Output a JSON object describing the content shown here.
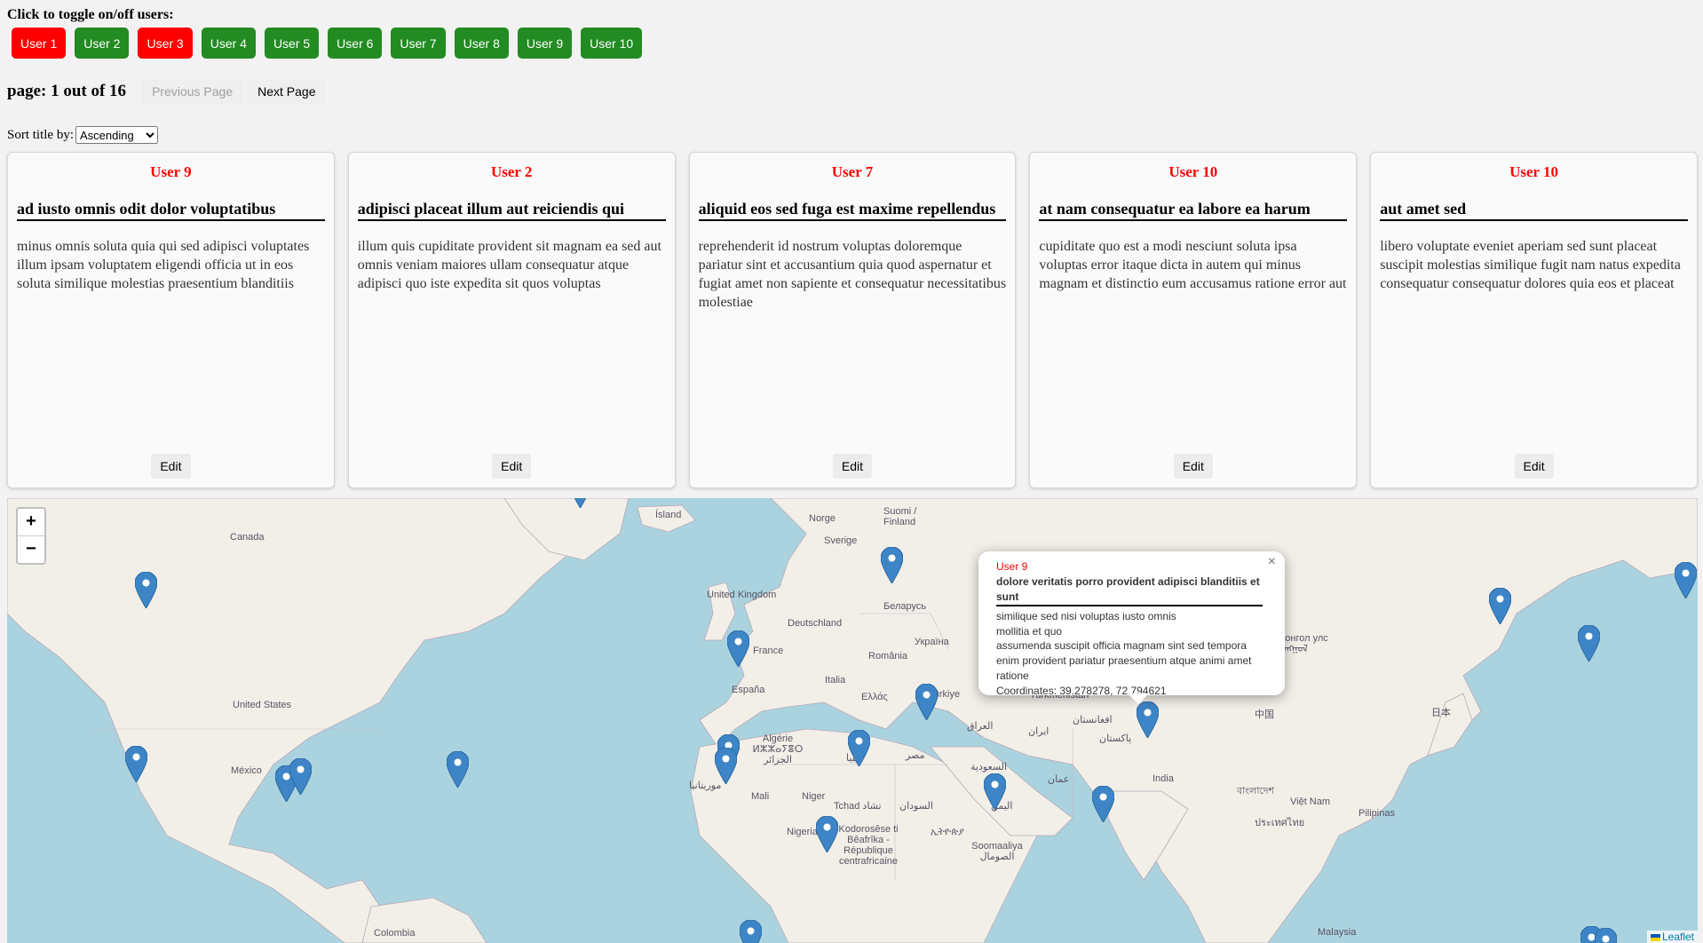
{
  "toggle": {
    "header": "Click to toggle on/off users:",
    "users": [
      {
        "label": "User 1",
        "state": "off"
      },
      {
        "label": "User 2",
        "state": "on"
      },
      {
        "label": "User 3",
        "state": "off"
      },
      {
        "label": "User 4",
        "state": "on"
      },
      {
        "label": "User 5",
        "state": "on"
      },
      {
        "label": "User 6",
        "state": "on"
      },
      {
        "label": "User 7",
        "state": "on"
      },
      {
        "label": "User 8",
        "state": "on"
      },
      {
        "label": "User 9",
        "state": "on"
      },
      {
        "label": "User 10",
        "state": "on"
      }
    ],
    "colors": {
      "on": "#228b22",
      "off": "#ff0000"
    }
  },
  "pager": {
    "label": "page: 1 out of 16",
    "prev": "Previous Page",
    "next": "Next Page"
  },
  "sort": {
    "label": "Sort title by:",
    "selected": "Ascending"
  },
  "cards": [
    {
      "user": "User 9",
      "title": "ad iusto omnis odit dolor voluptatibus",
      "body": "minus omnis soluta quia qui sed adipisci voluptates illum ipsam voluptatem eligendi officia ut in eos soluta similique molestias praesentium blanditiis",
      "edit": "Edit"
    },
    {
      "user": "User 2",
      "title": "adipisci placeat illum aut reiciendis qui",
      "body": "illum quis cupiditate provident sit magnam ea sed aut omnis veniam maiores ullam consequatur atque adipisci quo iste expedita sit quos voluptas",
      "edit": "Edit"
    },
    {
      "user": "User 7",
      "title": "aliquid eos sed fuga est maxime repellendus",
      "body": "reprehenderit id nostrum voluptas doloremque pariatur sint et accusantium quia quod aspernatur et fugiat amet non sapiente et consequatur necessitatibus molestiae",
      "edit": "Edit"
    },
    {
      "user": "User 10",
      "title": "at nam consequatur ea labore ea harum",
      "body": "cupiditate quo est a modi nesciunt soluta ipsa voluptas error itaque dicta in autem qui minus magnam et distinctio eum accusamus ratione error aut",
      "edit": "Edit"
    },
    {
      "user": "User 10",
      "title": "aut amet sed",
      "body": "libero voluptate eveniet aperiam sed sunt placeat suscipit molestias similique fugit nam natus expedita consequatur consequatur dolores quia eos et placeat",
      "edit": "Edit"
    }
  ],
  "map": {
    "zoom_in": "+",
    "zoom_out": "−",
    "attribution": "Leaflet",
    "labels": {
      "canada": "Canada",
      "united_states": "United States",
      "mexico": "México",
      "colombia": "Colombia",
      "island": "Ísland",
      "norge": "Norge",
      "sverige": "Sverige",
      "suomi": "Suomi / Finland",
      "uk": "United Kingdom",
      "deutschland": "Deutschland",
      "belarus": "Беларусь",
      "ukraina": "Україна",
      "france": "France",
      "romania": "România",
      "italia": "Italia",
      "espana": "España",
      "ellas": "Ελλάς",
      "turkiye": "Türkiye",
      "turkmenistan": "Turkmenistan",
      "algerie": "Algérie ⵍⵣⵣⴰⵢⴻⵔ الجزائر",
      "libya": "ليبيا",
      "misr": "مصر",
      "iraq": "العراق",
      "iran": "ایران",
      "afghanistan": "افغانستان",
      "pakistan": "پاکستان",
      "india": "India",
      "china": "中国",
      "japan": "日本",
      "mongolia": "Монгол улс ᠮᠣᠩᠭᠣᠯ",
      "mauritania": "موريتانيا",
      "mali": "Mali",
      "niger": "Niger",
      "tchad": "Tchad تشاد",
      "sudan": "السودان",
      "saudi": "السعودية",
      "yemen": "اليمن",
      "oman": "عمان",
      "nigeria": "Nigeria",
      "ethiopia": "ኢትዮጵያ",
      "kongo": "Kodorosêse ti Bêafrîka - République centrafricaine",
      "somalia": "Soomaaliya الصومال",
      "vietnam": "Việt Nam",
      "thailand": "ประเทศไทย",
      "pilipinas": "Pilipinas",
      "malaysia": "Malaysia",
      "bangladesh": "বাংলাদেশ"
    }
  },
  "popup": {
    "close": "×",
    "user": "User 9",
    "title": "dolore veritatis porro provident adipisci blanditiis et sunt",
    "body_lines": [
      "similique sed nisi voluptas iusto omnis",
      "mollitia et quo",
      "assumenda suscipit officia magnam sint sed tempora",
      "enim provident pariatur praesentium atque animi amet ratione"
    ],
    "coordinates": "Coordinates: 39.278278, 72.794621"
  }
}
